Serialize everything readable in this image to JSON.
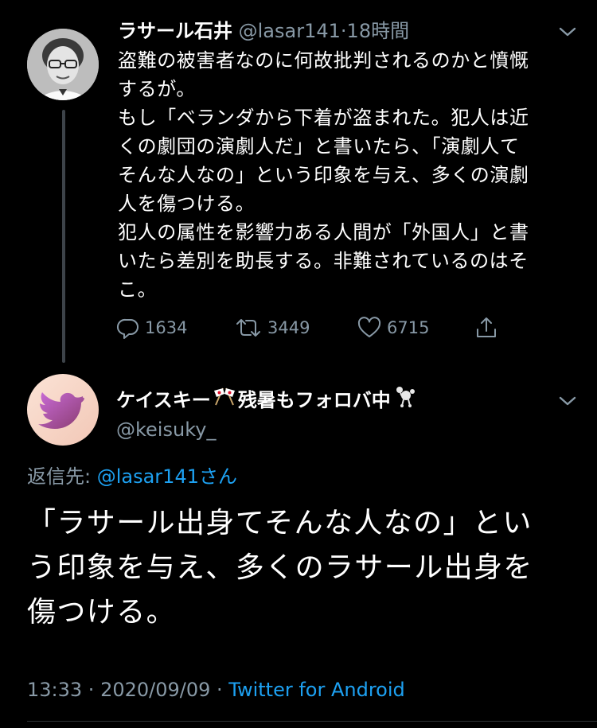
{
  "parent_tweet": {
    "display_name": "ラサール石井",
    "handle": "@lasar141",
    "separator": "·",
    "time_ago": "18時間",
    "lines": [
      "盗難の被害者なのに何故批判されるのかと憤慨",
      "するが。",
      "もし「ベランダから下着が盗まれた。犯人は近",
      "くの劇団の演劇人だ」と書いたら、「演劇人て",
      "そんな人なの」という印象を与え、多くの演劇",
      "人を傷つける。",
      "犯人の属性を影響力ある人間が「外国人」と書",
      "いたら差別を助長する。非難されているのはそ",
      "こ。"
    ],
    "actions": {
      "replies": "1634",
      "retweets": "3449",
      "likes": "6715"
    }
  },
  "reply_tweet": {
    "display_name_part1": "ケイスキー",
    "display_name_part2": "残暑もフォロバ中",
    "handle": "@keisuky_",
    "reply_to_prefix": "返信先: ",
    "reply_to_mention": "@lasar141さん",
    "lines": [
      "「ラサール出身てそんな人なの」とい",
      "う印象を与え、多くのラサール出身を",
      "傷つける。"
    ],
    "time": "13:33",
    "separator": " · ",
    "date": "2020/09/09",
    "separator2": " · ",
    "source": "Twitter for Android"
  },
  "icons": {
    "parent_more": "chevron-down-icon",
    "reply_more": "chevron-down-icon",
    "reply": "reply-icon",
    "retweet": "retweet-icon",
    "like": "like-icon",
    "share": "share-icon",
    "flag_emoji": "crossed-flags-icon",
    "poodle_emoji": "poodle-icon"
  },
  "colors": {
    "background": "#000000",
    "text_primary": "#ffffff",
    "text_secondary": "#8899a6",
    "accent": "#1da1f2",
    "thread_line": "#3d4349"
  }
}
